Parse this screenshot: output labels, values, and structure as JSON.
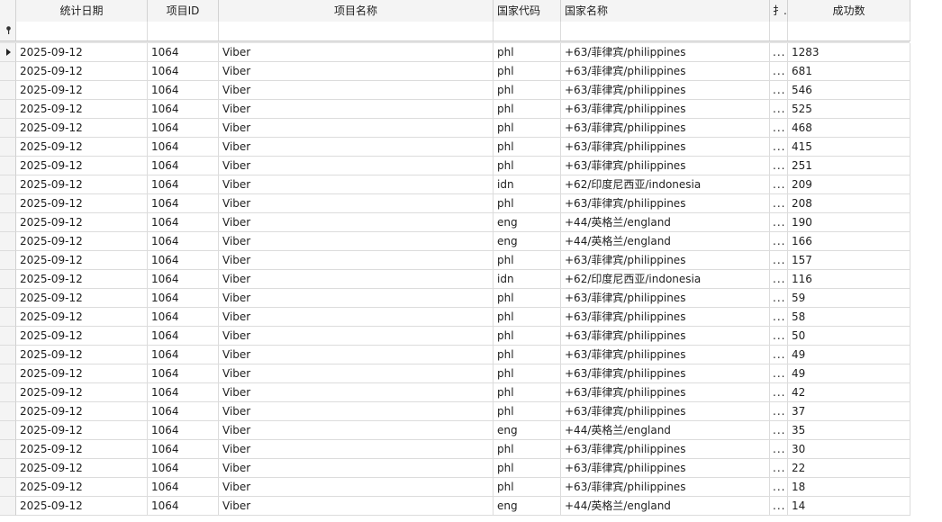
{
  "columns": [
    "统计日期",
    "项目ID",
    "项目名称",
    "国家代码",
    "国家名称",
    "扌..",
    "成功数"
  ],
  "rows": [
    {
      "date": "2025-09-12",
      "pid": "1064",
      "pname": "Viber",
      "code": "phl",
      "country": "+63/菲律宾/philippines",
      "ext": "...",
      "count": "1283"
    },
    {
      "date": "2025-09-12",
      "pid": "1064",
      "pname": "Viber",
      "code": "phl",
      "country": "+63/菲律宾/philippines",
      "ext": "...",
      "count": "681"
    },
    {
      "date": "2025-09-12",
      "pid": "1064",
      "pname": "Viber",
      "code": "phl",
      "country": "+63/菲律宾/philippines",
      "ext": "...",
      "count": "546"
    },
    {
      "date": "2025-09-12",
      "pid": "1064",
      "pname": "Viber",
      "code": "phl",
      "country": "+63/菲律宾/philippines",
      "ext": "...",
      "count": "525"
    },
    {
      "date": "2025-09-12",
      "pid": "1064",
      "pname": "Viber",
      "code": "phl",
      "country": "+63/菲律宾/philippines",
      "ext": "...",
      "count": "468"
    },
    {
      "date": "2025-09-12",
      "pid": "1064",
      "pname": "Viber",
      "code": "phl",
      "country": "+63/菲律宾/philippines",
      "ext": "...",
      "count": "415"
    },
    {
      "date": "2025-09-12",
      "pid": "1064",
      "pname": "Viber",
      "code": "phl",
      "country": "+63/菲律宾/philippines",
      "ext": "...",
      "count": "251"
    },
    {
      "date": "2025-09-12",
      "pid": "1064",
      "pname": "Viber",
      "code": "idn",
      "country": "+62/印度尼西亚/indonesia",
      "ext": "...",
      "count": "209"
    },
    {
      "date": "2025-09-12",
      "pid": "1064",
      "pname": "Viber",
      "code": "phl",
      "country": "+63/菲律宾/philippines",
      "ext": "...",
      "count": "208"
    },
    {
      "date": "2025-09-12",
      "pid": "1064",
      "pname": "Viber",
      "code": "eng",
      "country": "+44/英格兰/england",
      "ext": "...",
      "count": "190"
    },
    {
      "date": "2025-09-12",
      "pid": "1064",
      "pname": "Viber",
      "code": "eng",
      "country": "+44/英格兰/england",
      "ext": "...",
      "count": "166"
    },
    {
      "date": "2025-09-12",
      "pid": "1064",
      "pname": "Viber",
      "code": "phl",
      "country": "+63/菲律宾/philippines",
      "ext": "...",
      "count": "157"
    },
    {
      "date": "2025-09-12",
      "pid": "1064",
      "pname": "Viber",
      "code": "idn",
      "country": "+62/印度尼西亚/indonesia",
      "ext": "...",
      "count": "116"
    },
    {
      "date": "2025-09-12",
      "pid": "1064",
      "pname": "Viber",
      "code": "phl",
      "country": "+63/菲律宾/philippines",
      "ext": "...",
      "count": "59"
    },
    {
      "date": "2025-09-12",
      "pid": "1064",
      "pname": "Viber",
      "code": "phl",
      "country": "+63/菲律宾/philippines",
      "ext": "...",
      "count": "58"
    },
    {
      "date": "2025-09-12",
      "pid": "1064",
      "pname": "Viber",
      "code": "phl",
      "country": "+63/菲律宾/philippines",
      "ext": "...",
      "count": "50"
    },
    {
      "date": "2025-09-12",
      "pid": "1064",
      "pname": "Viber",
      "code": "phl",
      "country": "+63/菲律宾/philippines",
      "ext": "...",
      "count": "49"
    },
    {
      "date": "2025-09-12",
      "pid": "1064",
      "pname": "Viber",
      "code": "phl",
      "country": "+63/菲律宾/philippines",
      "ext": "...",
      "count": "49"
    },
    {
      "date": "2025-09-12",
      "pid": "1064",
      "pname": "Viber",
      "code": "phl",
      "country": "+63/菲律宾/philippines",
      "ext": "...",
      "count": "42"
    },
    {
      "date": "2025-09-12",
      "pid": "1064",
      "pname": "Viber",
      "code": "phl",
      "country": "+63/菲律宾/philippines",
      "ext": "...",
      "count": "37"
    },
    {
      "date": "2025-09-12",
      "pid": "1064",
      "pname": "Viber",
      "code": "eng",
      "country": "+44/英格兰/england",
      "ext": "...",
      "count": "35"
    },
    {
      "date": "2025-09-12",
      "pid": "1064",
      "pname": "Viber",
      "code": "phl",
      "country": "+63/菲律宾/philippines",
      "ext": "...",
      "count": "30"
    },
    {
      "date": "2025-09-12",
      "pid": "1064",
      "pname": "Viber",
      "code": "phl",
      "country": "+63/菲律宾/philippines",
      "ext": "...",
      "count": "22"
    },
    {
      "date": "2025-09-12",
      "pid": "1064",
      "pname": "Viber",
      "code": "phl",
      "country": "+63/菲律宾/philippines",
      "ext": "...",
      "count": "18"
    },
    {
      "date": "2025-09-12",
      "pid": "1064",
      "pname": "Viber",
      "code": "eng",
      "country": "+44/英格兰/england",
      "ext": "...",
      "count": "14"
    }
  ],
  "current_row_index": 0,
  "icons": {
    "row_indicator": "current-row-arrow-icon",
    "filter": "filter-pin-icon"
  },
  "colors": {
    "header_bg": "#f4f4f4",
    "grid_line": "#dcdcdc",
    "text": "#1e1e1e"
  }
}
